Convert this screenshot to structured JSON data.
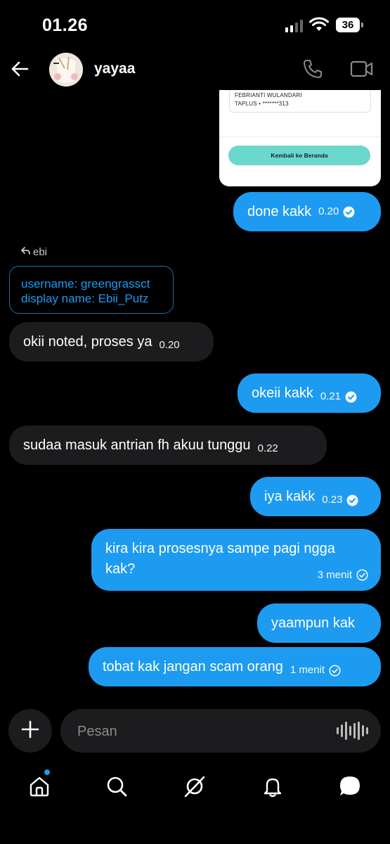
{
  "status_bar": {
    "time": "01.26",
    "battery": "36"
  },
  "header": {
    "contact_name": "yayaa"
  },
  "image_card": {
    "line1": "FEBRIANTI WULANDARI",
    "line2": "TAPLUS • *******313",
    "button_label": "Kembali ke Beranda"
  },
  "messages": [
    {
      "direction": "out",
      "text": "done kakk",
      "time": "0.20",
      "read": true
    },
    {
      "direction": "in",
      "reply_to": "ebi",
      "quote_line1": "username: greengrassct",
      "quote_line2": "display name: Ebii_Putz"
    },
    {
      "direction": "in",
      "text": "okii noted, proses ya",
      "time": "0.20"
    },
    {
      "direction": "out",
      "text": "okeii kakk",
      "time": "0.21",
      "read": true
    },
    {
      "direction": "in",
      "text": "sudaa masuk antrian fh akuu tunggu",
      "time": "0.22"
    },
    {
      "direction": "out",
      "text": "iya kakk",
      "time": "0.23",
      "read": true
    },
    {
      "direction": "out",
      "text": "kira kira prosesnya sampe pagi ngga kak?",
      "time": "3 menit",
      "read": false
    },
    {
      "direction": "out",
      "text": "yaampun kak"
    },
    {
      "direction": "out",
      "text": "tobat kak jangan scam orang",
      "time": "1 menit",
      "read": false
    }
  ],
  "composer": {
    "placeholder": "Pesan"
  },
  "nav": {
    "items": [
      "home-icon",
      "search-icon",
      "grok-icon",
      "notifications-icon",
      "messages-icon"
    ]
  },
  "colors": {
    "accent": "#1d9bf0",
    "incoming": "#1c1c1e",
    "background": "#000000",
    "image_button": "#6bd7cd"
  }
}
